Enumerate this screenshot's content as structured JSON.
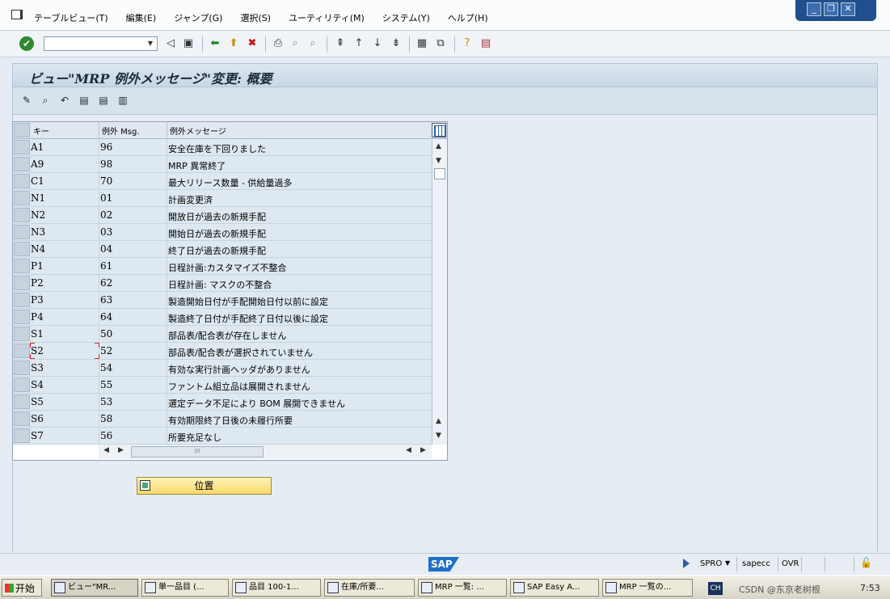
{
  "menu": {
    "items": [
      "テーブルビュー(T)",
      "編集(E)",
      "ジャンプ(G)",
      "選択(S)",
      "ユーティリティ(M)",
      "システム(Y)",
      "ヘルプ(H)"
    ]
  },
  "window_controls": {
    "minimize": "_",
    "restore": "❐",
    "close": "✕"
  },
  "toolbar": {
    "command_value": "",
    "icons": [
      "save-icon",
      "back-icon",
      "exit-icon",
      "cancel-icon",
      "print-icon",
      "find-icon",
      "find-next-icon",
      "first-page-icon",
      "prev-page-icon",
      "next-page-icon",
      "last-page-icon",
      "layout-icon",
      "new-session-icon",
      "help-icon",
      "customize-icon"
    ]
  },
  "title": "ビュー\"MRP 例外メッセージ\"変更: 概要",
  "table": {
    "headers": {
      "key": "キー",
      "msg": "例外 Msg.",
      "text": "例外メッセージ"
    },
    "rows": [
      {
        "key": "A1",
        "msg": "96",
        "text": "安全在庫を下回りました"
      },
      {
        "key": "A9",
        "msg": "98",
        "text": "MRP 異常終了"
      },
      {
        "key": "C1",
        "msg": "70",
        "text": "最大リリース数量 - 供給量過多"
      },
      {
        "key": "N1",
        "msg": "01",
        "text": "計画変更済"
      },
      {
        "key": "N2",
        "msg": "02",
        "text": "開放日が過去の新規手配"
      },
      {
        "key": "N3",
        "msg": "03",
        "text": "開始日が過去の新規手配"
      },
      {
        "key": "N4",
        "msg": "04",
        "text": "終了日が過去の新規手配"
      },
      {
        "key": "P1",
        "msg": "61",
        "text": "日程計画:カスタマイズ不整合"
      },
      {
        "key": "P2",
        "msg": "62",
        "text": "日程計画: マスクの不整合"
      },
      {
        "key": "P3",
        "msg": "63",
        "text": "製造開始日付が手配開始日付以前に設定"
      },
      {
        "key": "P4",
        "msg": "64",
        "text": "製造終了日付が手配終了日付以後に設定"
      },
      {
        "key": "S1",
        "msg": "50",
        "text": "部品表/配合表が存在しません"
      },
      {
        "key": "S2",
        "msg": "52",
        "text": "部品表/配合表が選択されていません"
      },
      {
        "key": "S3",
        "msg": "54",
        "text": "有効な実行計画ヘッダがありません"
      },
      {
        "key": "S4",
        "msg": "55",
        "text": "ファントム組立品は展開されません"
      },
      {
        "key": "S5",
        "msg": "53",
        "text": "選定データ不足により BOM 展開できません"
      },
      {
        "key": "S6",
        "msg": "58",
        "text": "有効期限終了日後の未履行所要"
      },
      {
        "key": "S7",
        "msg": "56",
        "text": "所要充足なし"
      }
    ]
  },
  "position_button": "位置",
  "status": {
    "transaction": "SPRO",
    "system": "sapecc",
    "mode": "OVR"
  },
  "taskbar": {
    "start": "开始",
    "tasks": [
      "ビュー\"MR...",
      "単一品目 (...",
      "品目 100-1...",
      "在庫/所要...",
      "MRP 一覧: ...",
      "SAP Easy A...",
      "MRP 一覧の..."
    ],
    "lang": "CH",
    "watermark": "CSDN @东京老树根",
    "clock": "7:53"
  }
}
